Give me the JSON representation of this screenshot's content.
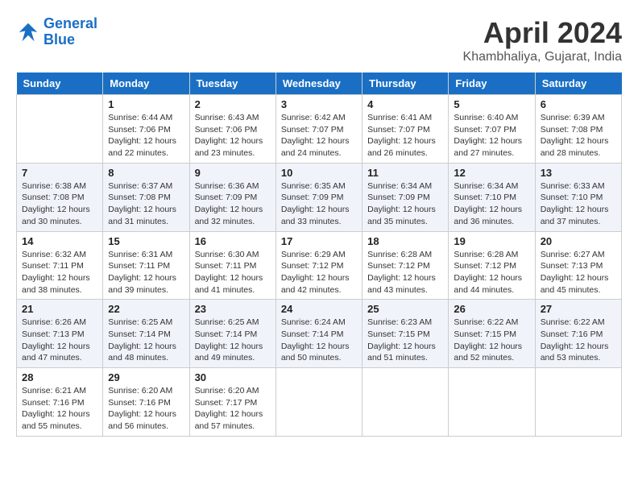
{
  "header": {
    "logo_line1": "General",
    "logo_line2": "Blue",
    "month_year": "April 2024",
    "location": "Khambhaliya, Gujarat, India"
  },
  "weekdays": [
    "Sunday",
    "Monday",
    "Tuesday",
    "Wednesday",
    "Thursday",
    "Friday",
    "Saturday"
  ],
  "weeks": [
    [
      {
        "day": "",
        "info": ""
      },
      {
        "day": "1",
        "info": "Sunrise: 6:44 AM\nSunset: 7:06 PM\nDaylight: 12 hours\nand 22 minutes."
      },
      {
        "day": "2",
        "info": "Sunrise: 6:43 AM\nSunset: 7:06 PM\nDaylight: 12 hours\nand 23 minutes."
      },
      {
        "day": "3",
        "info": "Sunrise: 6:42 AM\nSunset: 7:07 PM\nDaylight: 12 hours\nand 24 minutes."
      },
      {
        "day": "4",
        "info": "Sunrise: 6:41 AM\nSunset: 7:07 PM\nDaylight: 12 hours\nand 26 minutes."
      },
      {
        "day": "5",
        "info": "Sunrise: 6:40 AM\nSunset: 7:07 PM\nDaylight: 12 hours\nand 27 minutes."
      },
      {
        "day": "6",
        "info": "Sunrise: 6:39 AM\nSunset: 7:08 PM\nDaylight: 12 hours\nand 28 minutes."
      }
    ],
    [
      {
        "day": "7",
        "info": "Sunrise: 6:38 AM\nSunset: 7:08 PM\nDaylight: 12 hours\nand 30 minutes."
      },
      {
        "day": "8",
        "info": "Sunrise: 6:37 AM\nSunset: 7:08 PM\nDaylight: 12 hours\nand 31 minutes."
      },
      {
        "day": "9",
        "info": "Sunrise: 6:36 AM\nSunset: 7:09 PM\nDaylight: 12 hours\nand 32 minutes."
      },
      {
        "day": "10",
        "info": "Sunrise: 6:35 AM\nSunset: 7:09 PM\nDaylight: 12 hours\nand 33 minutes."
      },
      {
        "day": "11",
        "info": "Sunrise: 6:34 AM\nSunset: 7:09 PM\nDaylight: 12 hours\nand 35 minutes."
      },
      {
        "day": "12",
        "info": "Sunrise: 6:34 AM\nSunset: 7:10 PM\nDaylight: 12 hours\nand 36 minutes."
      },
      {
        "day": "13",
        "info": "Sunrise: 6:33 AM\nSunset: 7:10 PM\nDaylight: 12 hours\nand 37 minutes."
      }
    ],
    [
      {
        "day": "14",
        "info": "Sunrise: 6:32 AM\nSunset: 7:11 PM\nDaylight: 12 hours\nand 38 minutes."
      },
      {
        "day": "15",
        "info": "Sunrise: 6:31 AM\nSunset: 7:11 PM\nDaylight: 12 hours\nand 39 minutes."
      },
      {
        "day": "16",
        "info": "Sunrise: 6:30 AM\nSunset: 7:11 PM\nDaylight: 12 hours\nand 41 minutes."
      },
      {
        "day": "17",
        "info": "Sunrise: 6:29 AM\nSunset: 7:12 PM\nDaylight: 12 hours\nand 42 minutes."
      },
      {
        "day": "18",
        "info": "Sunrise: 6:28 AM\nSunset: 7:12 PM\nDaylight: 12 hours\nand 43 minutes."
      },
      {
        "day": "19",
        "info": "Sunrise: 6:28 AM\nSunset: 7:12 PM\nDaylight: 12 hours\nand 44 minutes."
      },
      {
        "day": "20",
        "info": "Sunrise: 6:27 AM\nSunset: 7:13 PM\nDaylight: 12 hours\nand 45 minutes."
      }
    ],
    [
      {
        "day": "21",
        "info": "Sunrise: 6:26 AM\nSunset: 7:13 PM\nDaylight: 12 hours\nand 47 minutes."
      },
      {
        "day": "22",
        "info": "Sunrise: 6:25 AM\nSunset: 7:14 PM\nDaylight: 12 hours\nand 48 minutes."
      },
      {
        "day": "23",
        "info": "Sunrise: 6:25 AM\nSunset: 7:14 PM\nDaylight: 12 hours\nand 49 minutes."
      },
      {
        "day": "24",
        "info": "Sunrise: 6:24 AM\nSunset: 7:14 PM\nDaylight: 12 hours\nand 50 minutes."
      },
      {
        "day": "25",
        "info": "Sunrise: 6:23 AM\nSunset: 7:15 PM\nDaylight: 12 hours\nand 51 minutes."
      },
      {
        "day": "26",
        "info": "Sunrise: 6:22 AM\nSunset: 7:15 PM\nDaylight: 12 hours\nand 52 minutes."
      },
      {
        "day": "27",
        "info": "Sunrise: 6:22 AM\nSunset: 7:16 PM\nDaylight: 12 hours\nand 53 minutes."
      }
    ],
    [
      {
        "day": "28",
        "info": "Sunrise: 6:21 AM\nSunset: 7:16 PM\nDaylight: 12 hours\nand 55 minutes."
      },
      {
        "day": "29",
        "info": "Sunrise: 6:20 AM\nSunset: 7:16 PM\nDaylight: 12 hours\nand 56 minutes."
      },
      {
        "day": "30",
        "info": "Sunrise: 6:20 AM\nSunset: 7:17 PM\nDaylight: 12 hours\nand 57 minutes."
      },
      {
        "day": "",
        "info": ""
      },
      {
        "day": "",
        "info": ""
      },
      {
        "day": "",
        "info": ""
      },
      {
        "day": "",
        "info": ""
      }
    ]
  ]
}
